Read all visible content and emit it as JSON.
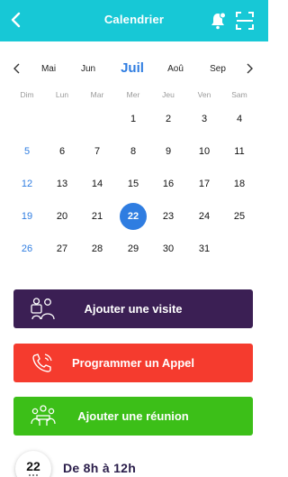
{
  "header": {
    "title": "Calendrier",
    "back_icon": "back-arrow-icon",
    "bell_icon": "notification-bell-icon",
    "scan_icon": "scan-icon",
    "background": "#17c8d6"
  },
  "calendar": {
    "months": [
      "Mai",
      "Jun",
      "Juil",
      "Aoû",
      "Sep"
    ],
    "active_month": "Juil",
    "weekdays": [
      "Dim",
      "Lun",
      "Mar",
      "Mer",
      "Jeu",
      "Ven",
      "Sam"
    ],
    "weeks": [
      [
        "",
        "",
        "",
        "1",
        "2",
        "3",
        "4"
      ],
      [
        "5",
        "6",
        "7",
        "8",
        "9",
        "10",
        "11"
      ],
      [
        "12",
        "13",
        "14",
        "15",
        "16",
        "17",
        "18"
      ],
      [
        "19",
        "20",
        "21",
        "22",
        "23",
        "24",
        "25"
      ],
      [
        "26",
        "27",
        "28",
        "29",
        "30",
        "31",
        ""
      ]
    ],
    "selected_day": "22",
    "accent_color": "#2f7de1"
  },
  "actions": {
    "visite": {
      "label": "Ajouter une visite",
      "icon": "visit-people-icon",
      "color": "#3b1f54"
    },
    "appel": {
      "label": "Programmer un Appel",
      "icon": "phone-call-icon",
      "color": "#f53b2e"
    },
    "reunion": {
      "label": "Ajouter une réunion",
      "icon": "meeting-group-icon",
      "color": "#3cbf18"
    }
  },
  "schedule": {
    "date": "22",
    "time_range": "De 8h à 12h"
  }
}
